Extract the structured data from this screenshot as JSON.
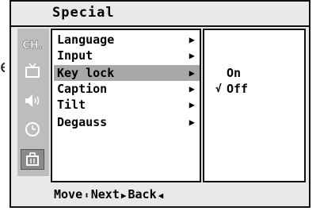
{
  "background_letter": "e",
  "osd": {
    "title": "Special",
    "side_icons": [
      {
        "name": "ch",
        "text": "CH."
      },
      {
        "name": "tv-icon"
      },
      {
        "name": "speaker-icon"
      },
      {
        "name": "clock-icon"
      },
      {
        "name": "special-icon",
        "active": true
      }
    ],
    "menu": {
      "items": [
        {
          "label": "Language",
          "arrow": "▶"
        },
        {
          "label": "Input",
          "arrow": "▶"
        },
        {
          "label": "Key lock",
          "arrow": "▶",
          "selected": true
        },
        {
          "label": "Caption",
          "arrow": "▶"
        },
        {
          "label": "Tilt",
          "arrow": "▶"
        },
        {
          "label": "Degauss",
          "arrow": "▶"
        }
      ]
    },
    "submenu": {
      "options": [
        {
          "label": "On",
          "checked": false
        },
        {
          "label": "Off",
          "checked": true,
          "mark": "√"
        }
      ]
    },
    "help": {
      "move_label": "Move",
      "move_glyph": "⬍",
      "next_label": "Next",
      "next_glyph": "▶",
      "back_label": "Back",
      "back_glyph": "◀"
    }
  },
  "colors": {
    "panel_bg": "#ffffff",
    "osd_bg": "#e9e9e9",
    "sidebar_bg": "#bdbdbd",
    "highlight": "#a8a8a8",
    "border": "#111111"
  }
}
